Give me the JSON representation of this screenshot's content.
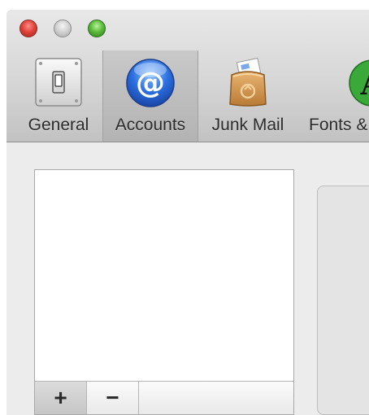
{
  "window": {
    "controls": [
      "close",
      "minimize",
      "zoom"
    ]
  },
  "toolbar": {
    "items": [
      {
        "label": "General",
        "icon": "light-switch-icon",
        "selected": false
      },
      {
        "label": "Accounts",
        "icon": "at-sign-icon",
        "selected": true
      },
      {
        "label": "Junk Mail",
        "icon": "junk-mail-bag-icon",
        "selected": false
      },
      {
        "label": "Fonts &",
        "icon": "fonts-icon",
        "selected": false
      }
    ]
  },
  "accounts": {
    "list_items": [],
    "add_button": "+",
    "remove_button": "−"
  },
  "colors": {
    "accent_blue": "#2b6fe0",
    "close_red": "#e0443b",
    "zoom_green": "#5dbb3c"
  }
}
